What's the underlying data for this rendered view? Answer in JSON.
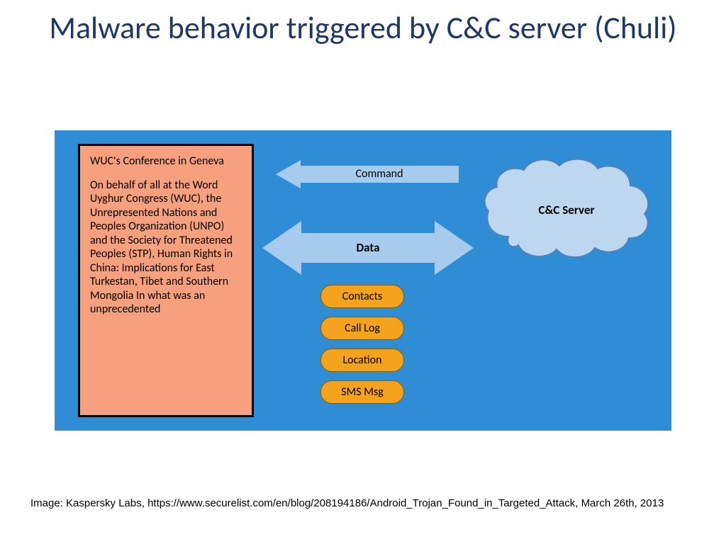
{
  "title": "Malware behavior triggered by C&C server (Chuli)",
  "email": {
    "heading": "WUC's Conference in Geneva",
    "body": "On behalf of all at the Word Uyghur Congress (WUC), the Unrepresented Nations and Peoples Organization (UNPO) and the Society for Threatened Peoples (STP), Human Rights in China: Implications for East Turkestan, Tibet and Southern Mongolia In what was an unprecedented"
  },
  "arrows": {
    "command": "Command",
    "data": "Data"
  },
  "data_types": [
    "Contacts",
    "Call Log",
    "Location",
    "SMS Msg"
  ],
  "cloud_label": "C&C Server",
  "credit": "Image: Kaspersky Labs, https://www.securelist.com/en/blog/208194186/Android_Trojan_Found_in_Targeted_Attack, March 26th, 2013"
}
